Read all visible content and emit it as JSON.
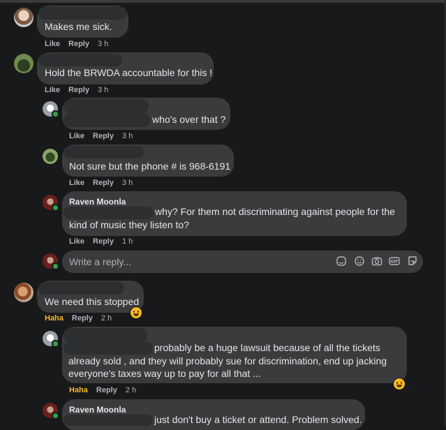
{
  "comments": [
    {
      "text": "Makes me sick.",
      "like": "Like",
      "reply": "Reply",
      "time": "3 h"
    },
    {
      "text": "Hold the BRWDA accountable for this !",
      "like": "Like",
      "reply": "Reply",
      "time": "3 h"
    },
    {
      "text": "who's over that ?",
      "like": "Like",
      "reply": "Reply",
      "time": "3 h"
    },
    {
      "text": "Not sure but the phone # is 968-6191",
      "like": "Like",
      "reply": "Reply",
      "time": "3 h"
    },
    {
      "author": "Raven Moonla",
      "line1": "why? For them not discriminating against people for the",
      "line2": "kind of music they listen to?",
      "like": "Like",
      "reply": "Reply",
      "time": "1 h"
    },
    {
      "text": "We need this stopped",
      "reaction": "Haha",
      "reply": "Reply",
      "time": "2 h"
    },
    {
      "line1": "probably be a huge lawsuit because of all the tickets",
      "line2": "already sold , and they will probably sue for discrimination, end up jacking",
      "line3": "everyone's taxes way up to pay for all that ...",
      "reaction": "Haha",
      "reply": "Reply",
      "time": "2 h"
    },
    {
      "author": "Raven Moonla",
      "line1": "just don't buy a ticket or attend. Problem solved."
    }
  ],
  "reply_box": {
    "placeholder": "Write a reply..."
  },
  "icons": {
    "reply_box": [
      "avatar-sticker-icon",
      "emoji-icon",
      "camera-icon",
      "gif-icon",
      "sticker-icon"
    ],
    "reaction": "haha-emoji-icon"
  },
  "colors": {
    "background": "#18191a",
    "bubble": "#3a3b3c",
    "haha": "#f7b928",
    "meta": "#b0b3b8"
  }
}
